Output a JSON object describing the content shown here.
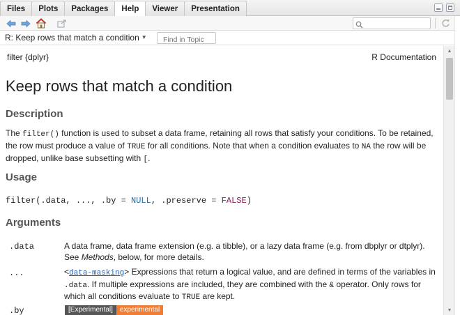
{
  "tabs": [
    {
      "label": "Files",
      "active": false
    },
    {
      "label": "Plots",
      "active": false
    },
    {
      "label": "Packages",
      "active": false
    },
    {
      "label": "Help",
      "active": true
    },
    {
      "label": "Viewer",
      "active": false
    },
    {
      "label": "Presentation",
      "active": false
    }
  ],
  "toolbar": {
    "icons": [
      "back-arrow-icon",
      "forward-arrow-icon",
      "home-icon",
      "open-in-window-icon"
    ],
    "search_value": "",
    "refresh_icon": "refresh-icon"
  },
  "topic": {
    "title": "R: Keep rows that match a condition",
    "find_placeholder": "Find in Topic"
  },
  "doc": {
    "package_line": "filter {dplyr}",
    "r_documentation": "R Documentation",
    "title": "Keep rows that match a condition",
    "description_heading": "Description",
    "description": {
      "p1": "The ",
      "code1": "filter()",
      "p2": " function is used to subset a data frame, retaining all rows that satisfy your conditions. To be retained, the row must produce a value of ",
      "code2": "TRUE",
      "p3": " for all conditions. Note that when a condition evaluates to ",
      "code3": "NA",
      "p4": " the row will be dropped, unlike base subsetting with ",
      "code4": "[",
      "p5": "."
    },
    "usage_heading": "Usage",
    "usage": {
      "pre": "filter(.data, ..., .by = ",
      "null_kw": "NULL",
      "mid": ", .preserve = ",
      "false_kw": "FALSE",
      "post": ")"
    },
    "arguments_heading": "Arguments",
    "arguments": [
      {
        "name": ".data",
        "desc_1": "A data frame, data frame extension (e.g. a tibble), or a lazy data frame (e.g. from dbplyr or dtplyr). See ",
        "desc_em": "Methods",
        "desc_2": ", below, for more details."
      },
      {
        "name": "...",
        "lt": "<",
        "link": "data-masking",
        "gt_text": "> Expressions that return a logical value, and are defined in terms of the variables in ",
        "code_data": ".data",
        "text2": ". If multiple expressions are included, they are combined with the ",
        "code_amp": "&",
        "text3": " operator. Only rows for which all conditions evaluate to ",
        "code_true": "TRUE",
        "text4": " are kept."
      },
      {
        "name": ".by",
        "badge_left": "[Experimental]",
        "badge_right": "experimental"
      }
    ]
  },
  "colors": {
    "null_keyword": "#1f6fa8",
    "false_keyword": "#8b1a5a",
    "link": "#1f5ea8",
    "heading": "#555555",
    "badge_orange": "#f07d33"
  }
}
